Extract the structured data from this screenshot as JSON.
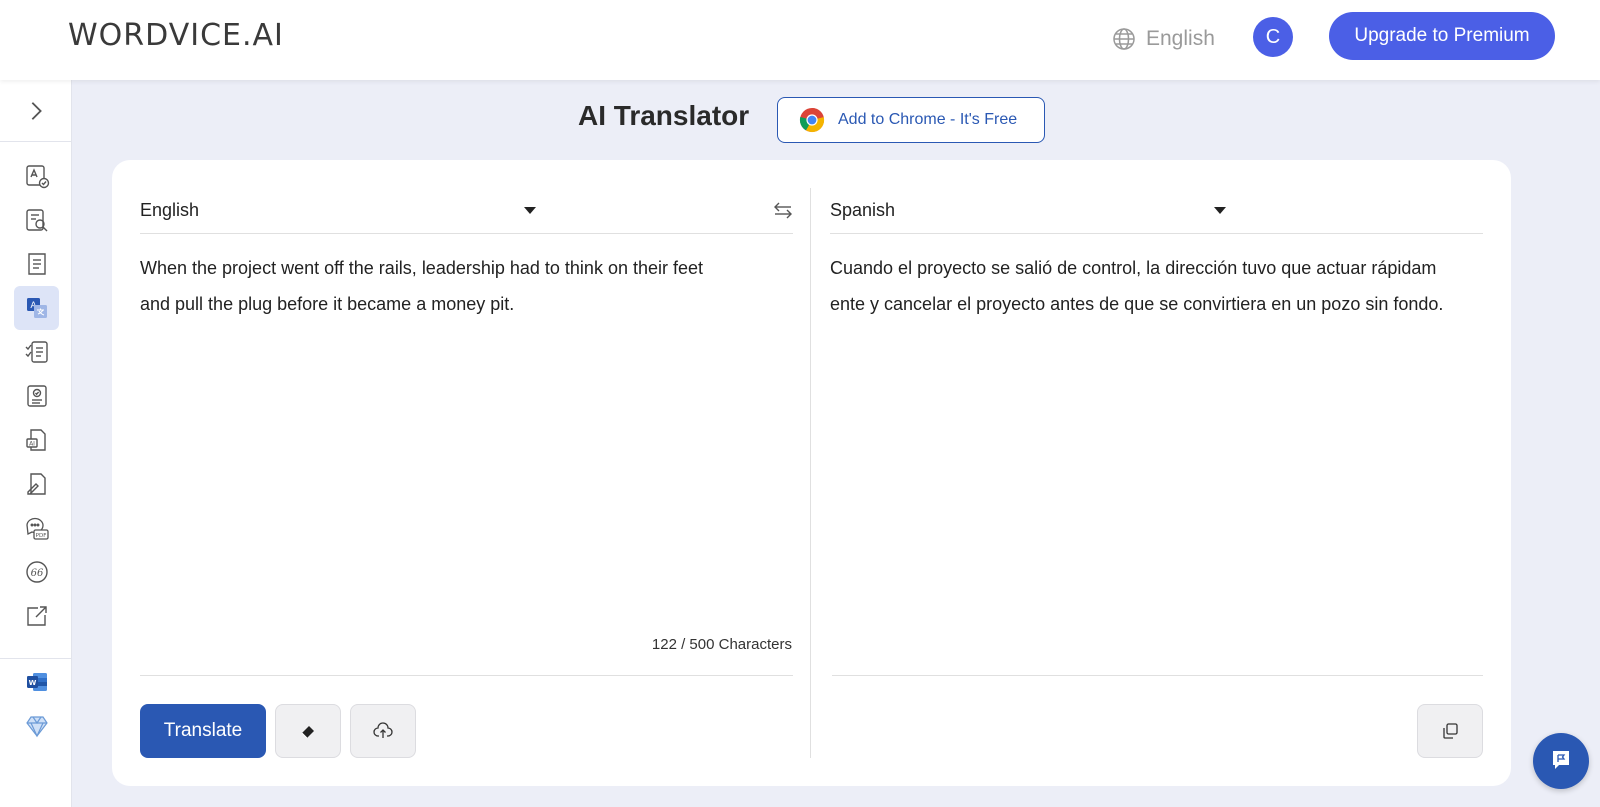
{
  "header": {
    "logo": "WORDVICE.AI",
    "language": "English",
    "avatar_initial": "C",
    "upgrade_label": "Upgrade to Premium"
  },
  "page": {
    "title": "AI Translator",
    "chrome_label": "Add to Chrome - It's Free"
  },
  "source": {
    "language": "English",
    "text_line1": "When the project went off the rails, leadership had to think on their feet",
    "text_line2": "and pull the plug before it became a money pit.",
    "char_count": "122 / 500 Characters"
  },
  "target": {
    "language": "Spanish",
    "text_line1": "Cuando el proyecto se salió de control, la dirección tuvo que actuar rápidam",
    "text_line2": "ente y cancelar el proyecto antes de que se convirtiera en un pozo sin fondo."
  },
  "actions": {
    "translate_label": "Translate"
  },
  "icons": {
    "sidebar": [
      "grammar-check-icon",
      "ai-detector-icon",
      "summarizer-icon",
      "translator-icon",
      "paraphraser-icon",
      "proofreader-icon",
      "ai-writer-icon",
      "editor-icon",
      "pdf-chat-icon",
      "citation-icon",
      "external-link-icon",
      "word-addin-icon",
      "premium-diamond-icon"
    ]
  },
  "colors": {
    "brand_blue": "#2a58b3",
    "premium_blue": "#4b5fe6",
    "background": "#eceef7"
  }
}
